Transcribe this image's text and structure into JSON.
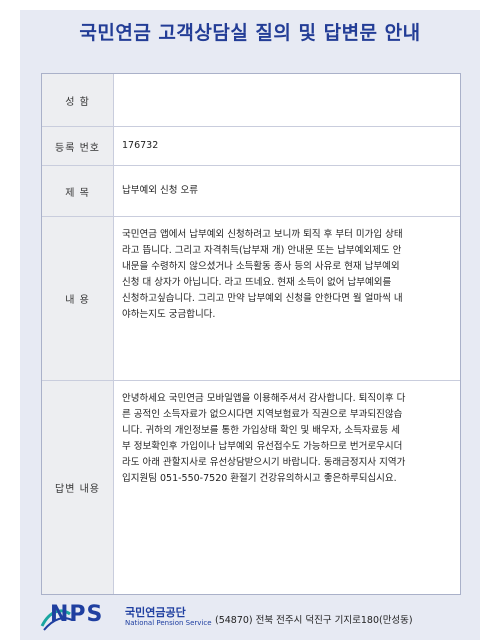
{
  "document": {
    "title": "국민연금 고객상담실 질의 및 답변문 안내"
  },
  "form": {
    "name": {
      "label": "성 함",
      "value": ""
    },
    "registration": {
      "label": "등록 번호",
      "value": "176732"
    },
    "subject": {
      "label": "제 목",
      "value": "납부예외 신청 오류"
    },
    "content": {
      "label": "내 용",
      "lines": [
        "국민연금 앱에서 납부예외 신청하려고 보니까 퇴직 후 부터 미가입 상태",
        "라고 뜹니다. 그리고 자격취득(납부재 개) 안내문 또는 납부예외제도 안",
        "내문을 수령하지 않으셨거나 소득활동 종사 등의 사유로 현재 납부예외",
        "신청 대 상자가 아닙니다. 라고 뜨네요. 현재 소득이 없어 납부예외를",
        "신청하고싶습니다. 그리고 만약 납부예외 신청을 안한다면 월 얼마씩 내",
        "야하는지도 궁금합니다."
      ]
    },
    "answer": {
      "label": "답변 내용",
      "lines": [
        "안녕하세요 국민연금 모바일앱을 이용해주셔서 감사합니다. 퇴직이후 다",
        "른 공적인 소득자료가 없으시다면 지역보험료가 직권으로 부과되진않습",
        "니다. 귀하의 개인정보를 통한 가입상태 확인 및 배우자, 소득자료등 세",
        "부 정보확인후 가입이나 납부예외 유선접수도 가능하므로 번거로우시더",
        "라도 아래 관할지사로 유선상담받으시기 바랍니다. 동래금정지사 지역가",
        "입지원팀 051-550-7520 환절기 건강유의하시고 좋은하루되십시요."
      ]
    }
  },
  "footer": {
    "logo_text": "NPS",
    "org_name_ko": "국민연금공단",
    "org_name_en": "National Pension Service",
    "address": "(54870) 전북 전주시 덕진구 기지로180(만성동)"
  },
  "colors": {
    "title": "#233d96",
    "frame_bg": "#e7eaf3",
    "label_bg": "#edeef1",
    "logo_blue": "#1f3fa0",
    "logo_swoosh": "#1aa6a0"
  }
}
